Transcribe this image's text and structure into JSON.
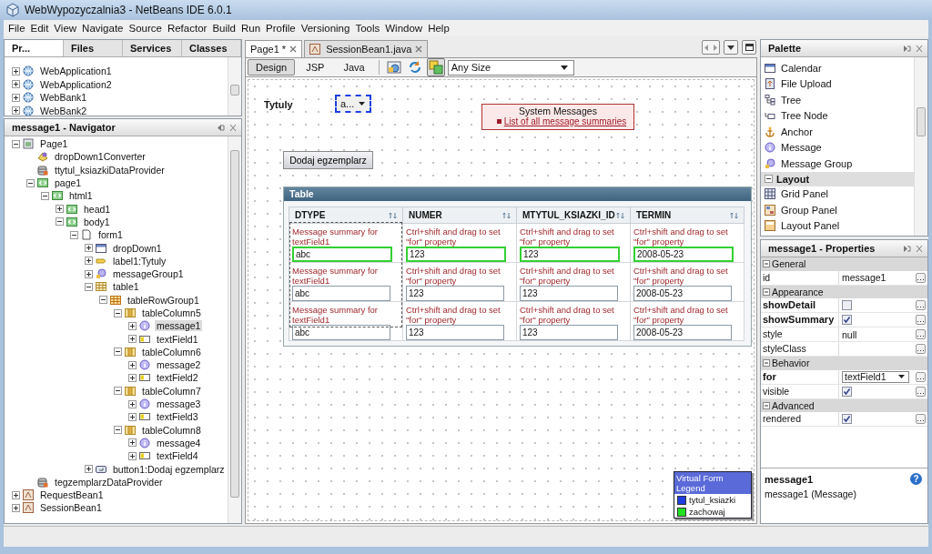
{
  "window": {
    "title": "WebWypozyczalnia3 - NetBeans IDE 6.0.1"
  },
  "menu": [
    "File",
    "Edit",
    "View",
    "Navigate",
    "Source",
    "Refactor",
    "Build",
    "Run",
    "Profile",
    "Versioning",
    "Tools",
    "Window",
    "Help"
  ],
  "projects": {
    "tabs": [
      {
        "label": "Pr...",
        "selected": true
      },
      {
        "label": "Files",
        "selected": false
      },
      {
        "label": "Services",
        "selected": false
      },
      {
        "label": "Classes",
        "selected": false
      }
    ],
    "items": [
      {
        "label": "WebApplication1",
        "kind": "globe",
        "expanded": false,
        "selected": false
      },
      {
        "label": "WebApplication2",
        "kind": "globe",
        "expanded": false,
        "selected": false
      },
      {
        "label": "WebBank1",
        "kind": "globe",
        "expanded": false,
        "selected": false
      },
      {
        "label": "WebBank2",
        "kind": "globe",
        "expanded": false,
        "selected": false
      }
    ]
  },
  "navigator": {
    "title": "message1 - Navigator",
    "tree": [
      {
        "label": "Page1",
        "kind": "page",
        "expanded": true,
        "selected": false,
        "children": [
          {
            "label": "dropDown1Converter",
            "kind": "converter",
            "selected": false
          },
          {
            "label": "ttytul_ksiazkiDataProvider",
            "kind": "db",
            "selected": false
          },
          {
            "label": "page1",
            "kind": "tag",
            "expanded": true,
            "selected": false,
            "children": [
              {
                "label": "html1",
                "kind": "tag",
                "expanded": true,
                "selected": false,
                "children": [
                  {
                    "label": "head1",
                    "kind": "tag",
                    "expanded": false,
                    "selected": false
                  },
                  {
                    "label": "body1",
                    "kind": "tag",
                    "expanded": true,
                    "selected": false,
                    "children": [
                      {
                        "label": "form1",
                        "kind": "form",
                        "expanded": true,
                        "selected": false,
                        "children": [
                          {
                            "label": "dropDown1",
                            "kind": "dropdown",
                            "expanded": false,
                            "selected": false
                          },
                          {
                            "label": "label1:Tytuly",
                            "kind": "label",
                            "expanded": false,
                            "selected": false
                          },
                          {
                            "label": "messageGroup1",
                            "kind": "msggroup",
                            "expanded": false,
                            "selected": false
                          },
                          {
                            "label": "table1",
                            "kind": "table",
                            "expanded": true,
                            "selected": false,
                            "children": [
                              {
                                "label": "tableRowGroup1",
                                "kind": "rowgroup",
                                "expanded": true,
                                "selected": false,
                                "children": [
                                  {
                                    "label": "tableColumn5",
                                    "kind": "column",
                                    "expanded": true,
                                    "selected": false,
                                    "children": [
                                      {
                                        "label": "message1",
                                        "kind": "message",
                                        "expanded": false,
                                        "selected": true
                                      },
                                      {
                                        "label": "textField1",
                                        "kind": "textfield",
                                        "expanded": false,
                                        "selected": false
                                      }
                                    ]
                                  },
                                  {
                                    "label": "tableColumn6",
                                    "kind": "column",
                                    "expanded": true,
                                    "selected": false,
                                    "children": [
                                      {
                                        "label": "message2",
                                        "kind": "message",
                                        "expanded": false,
                                        "selected": false
                                      },
                                      {
                                        "label": "textField2",
                                        "kind": "textfield",
                                        "expanded": false,
                                        "selected": false
                                      }
                                    ]
                                  },
                                  {
                                    "label": "tableColumn7",
                                    "kind": "column",
                                    "expanded": true,
                                    "selected": false,
                                    "children": [
                                      {
                                        "label": "message3",
                                        "kind": "message",
                                        "expanded": false,
                                        "selected": false
                                      },
                                      {
                                        "label": "textField3",
                                        "kind": "textfield",
                                        "expanded": false,
                                        "selected": false
                                      }
                                    ]
                                  },
                                  {
                                    "label": "tableColumn8",
                                    "kind": "column",
                                    "expanded": true,
                                    "selected": false,
                                    "children": [
                                      {
                                        "label": "message4",
                                        "kind": "message",
                                        "expanded": false,
                                        "selected": false
                                      },
                                      {
                                        "label": "textField4",
                                        "kind": "textfield",
                                        "expanded": false,
                                        "selected": false
                                      }
                                    ]
                                  }
                                ]
                              }
                            ]
                          },
                          {
                            "label": "button1:Dodaj egzemplarz",
                            "kind": "button",
                            "expanded": false,
                            "selected": false
                          }
                        ]
                      }
                    ]
                  }
                ]
              }
            ]
          },
          {
            "label": "tegzemplarzDataProvider",
            "kind": "db",
            "selected": false
          }
        ]
      },
      {
        "label": "RequestBean1",
        "kind": "bean",
        "expanded": false,
        "selected": false
      },
      {
        "label": "SessionBean1",
        "kind": "bean",
        "expanded": false,
        "selected": false
      }
    ]
  },
  "editor": {
    "tabs": [
      {
        "label": "Page1 *",
        "selected": true
      },
      {
        "label": "SessionBean1.java",
        "kind": "bean",
        "selected": false
      }
    ],
    "views": [
      {
        "label": "Design",
        "selected": true
      },
      {
        "label": "JSP",
        "selected": false
      },
      {
        "label": "Java",
        "selected": false
      }
    ],
    "virtual_forms_shown": true,
    "size": "Any Size",
    "canvas": {
      "label": "Tytuly",
      "dropdown": "a...",
      "messages": {
        "title": "System Messages",
        "summary": "List of all message summaries"
      },
      "button": "Dodaj egzemplarz",
      "table": {
        "title": "Table",
        "columns": [
          "DTYPE",
          "NUMER",
          "MTYTUL_KSIAZKI_ID",
          "TERMIN"
        ],
        "rows": [
          {
            "highlighted": true,
            "cells": [
              {
                "message": "Message summary for textField1",
                "value": "abc"
              },
              {
                "message": "Ctrl+shift and drag to set \"for\" property",
                "value": "123"
              },
              {
                "message": "Ctrl+shift and drag to set \"for\" property",
                "value": "123"
              },
              {
                "message": "Ctrl+shift and drag to set \"for\" property",
                "value": "2008-05-23"
              }
            ]
          },
          {
            "highlighted": false,
            "cells": [
              {
                "message": "Message summary for textField1",
                "value": "abc"
              },
              {
                "message": "Ctrl+shift and drag to set \"for\" property",
                "value": "123"
              },
              {
                "message": "Ctrl+shift and drag to set \"for\" property",
                "value": "123"
              },
              {
                "message": "Ctrl+shift and drag to set \"for\" property",
                "value": "2008-05-23"
              }
            ]
          },
          {
            "highlighted": false,
            "cells": [
              {
                "message": "Message summary for textField1",
                "value": "abc"
              },
              {
                "message": "Ctrl+shift and drag to set \"for\" property",
                "value": "123"
              },
              {
                "message": "Ctrl+shift and drag to set \"for\" property",
                "value": "123"
              },
              {
                "message": "Ctrl+shift and drag to set \"for\" property",
                "value": "2008-05-23"
              }
            ]
          }
        ]
      },
      "legend": {
        "title": "Virtual Form Legend",
        "items": [
          {
            "label": "tytul_ksiazki",
            "color": "#1f3fe0"
          },
          {
            "label": "zachowaj",
            "color": "#22e022"
          }
        ]
      }
    }
  },
  "palette": {
    "title": "Palette",
    "items": [
      {
        "kind": "calendar",
        "label": "Calendar"
      },
      {
        "kind": "upload",
        "label": "File Upload"
      },
      {
        "kind": "tree",
        "label": "Tree"
      },
      {
        "kind": "treenode",
        "label": "Tree Node"
      },
      {
        "kind": "anchor",
        "label": "Anchor"
      },
      {
        "kind": "message",
        "label": "Message"
      },
      {
        "kind": "msggroup",
        "label": "Message Group"
      },
      {
        "kind": "category",
        "label": "Layout",
        "expanded": true
      },
      {
        "kind": "grid",
        "label": "Grid Panel"
      },
      {
        "kind": "group",
        "label": "Group Panel"
      },
      {
        "kind": "layoutpanel",
        "label": "Layout Panel"
      }
    ]
  },
  "properties": {
    "title": "message1 - Properties",
    "groups": [
      {
        "label": "General",
        "expanded": true,
        "rows": [
          {
            "name": "id",
            "kind": "text",
            "value": "message1",
            "modified": false
          }
        ]
      },
      {
        "label": "Appearance",
        "expanded": true,
        "rows": [
          {
            "name": "showDetail",
            "kind": "checkbox",
            "checked": false,
            "modified": true
          },
          {
            "name": "showSummary",
            "kind": "checkbox",
            "checked": true,
            "modified": true
          },
          {
            "name": "style",
            "kind": "text",
            "value": "null",
            "modified": false
          },
          {
            "name": "styleClass",
            "kind": "text",
            "modified": false
          }
        ]
      },
      {
        "label": "Behavior",
        "expanded": true,
        "rows": [
          {
            "name": "for",
            "kind": "dropdown",
            "value": "textField1",
            "modified": true
          },
          {
            "name": "visible",
            "kind": "checkbox",
            "checked": true,
            "modified": false
          }
        ]
      },
      {
        "label": "Advanced",
        "expanded": true,
        "rows": [
          {
            "name": "rendered",
            "kind": "checkbox",
            "checked": true,
            "modified": false
          }
        ]
      }
    ],
    "help": {
      "title": "message1",
      "text": "message1 (Message)",
      "icon": "?"
    }
  }
}
